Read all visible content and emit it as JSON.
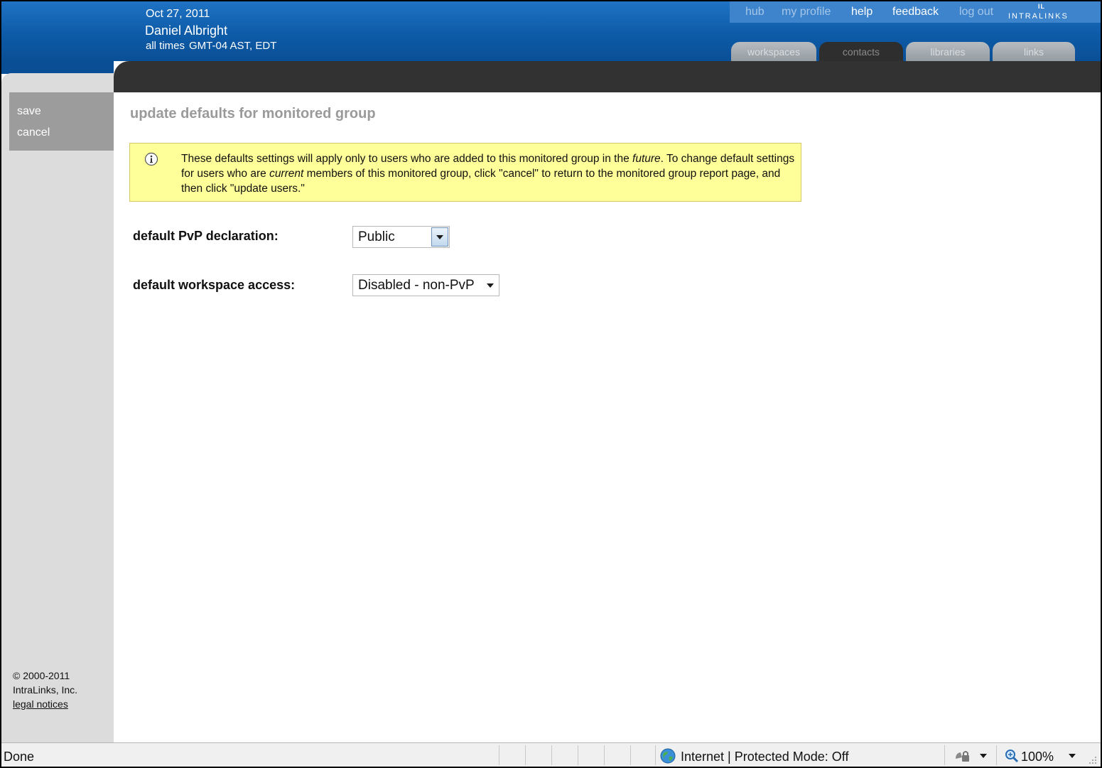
{
  "header": {
    "date": "Oct 27, 2011",
    "user_name": "Daniel Albright",
    "tz_prefix": "all times",
    "tz_value": "GMT-04 AST, EDT"
  },
  "top_nav": {
    "links": [
      "hub",
      "my profile",
      "help",
      "feedback",
      "log out"
    ],
    "logo_text": "INTRALINKS",
    "logo_mark": "IL"
  },
  "tabs": [
    {
      "label": "workspaces",
      "active": false
    },
    {
      "label": "contacts",
      "active": true
    },
    {
      "label": "libraries",
      "active": false
    },
    {
      "label": "links",
      "active": false
    }
  ],
  "sidebar": {
    "actions": [
      "save",
      "cancel"
    ],
    "copyright": "© 2000-2011",
    "company": "IntraLinks, Inc.",
    "legal": "legal notices"
  },
  "main": {
    "title": "update defaults for monitored group",
    "notice": {
      "part1": "These defaults settings will apply only to users who are added to this monitored group in the ",
      "em1": "future",
      "part2": ". To change default settings for users who are ",
      "em2": "current",
      "part3": " members of this monitored group, click \"cancel\" to return to the monitored group report page, and then click \"update users.\""
    },
    "fields": [
      {
        "label": "default PvP declaration:",
        "value": "Public"
      },
      {
        "label": "default workspace access:",
        "value": "Disabled - non-PvP"
      }
    ]
  },
  "statusbar": {
    "status": "Done",
    "zone": "Internet | Protected Mode: Off",
    "zoom": "100%"
  },
  "colors": {
    "header_blue": "#0d5ba8",
    "notice_yellow": "#ffff99",
    "dark_bar": "#323232",
    "sidebar_gray": "#dcdcdc"
  }
}
